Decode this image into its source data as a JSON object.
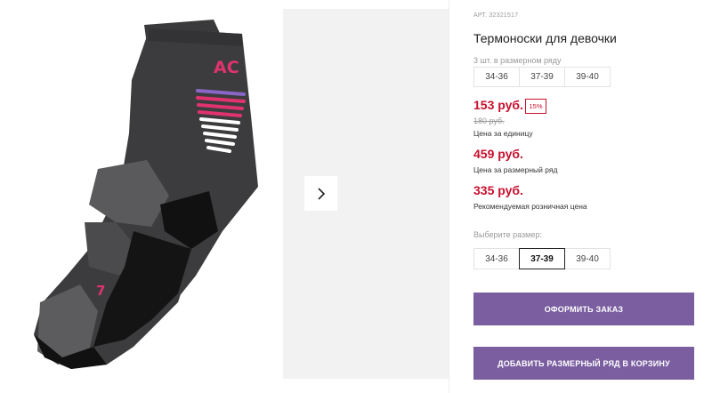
{
  "product": {
    "art": "АРТ. 32321517",
    "title": "Термоноски для девочки",
    "pack_note": "3 шт. в размерном ряду",
    "pack_sizes": [
      "34-36",
      "37-39",
      "39-40"
    ],
    "unit_price": "153 руб.",
    "discount": "15%",
    "old_price": "180 руб.",
    "unit_price_label": "Цена за единицу",
    "row_price": "459 руб.",
    "row_price_label": "Цена за размерный ряд",
    "retail_price": "335 руб.",
    "retail_price_label": "Рекомендуемая розничная цена",
    "choose_size_label": "Выберите размер:",
    "sizes": [
      "34-36",
      "37-39",
      "39-40"
    ],
    "selected_size": "37-39"
  },
  "buttons": {
    "order": "ОФОРМИТЬ ЗАКАЗ",
    "add_row": "ДОБАВИТЬ РАЗМЕРНЫЙ РЯД В КОРЗИНУ"
  },
  "photo": {
    "brand_text": "AC",
    "heel_mark": "7"
  },
  "colors": {
    "price_red": "#c8102e",
    "button_purple": "#7a5ea0",
    "sock_dark": "#3a3a3c",
    "sock_mid": "#58585a",
    "sock_black": "#111111",
    "stripe_pink": "#e0336e",
    "stripe_violet": "#8a66c8"
  },
  "icons": {
    "next_arrow": "chevron-right-icon"
  }
}
